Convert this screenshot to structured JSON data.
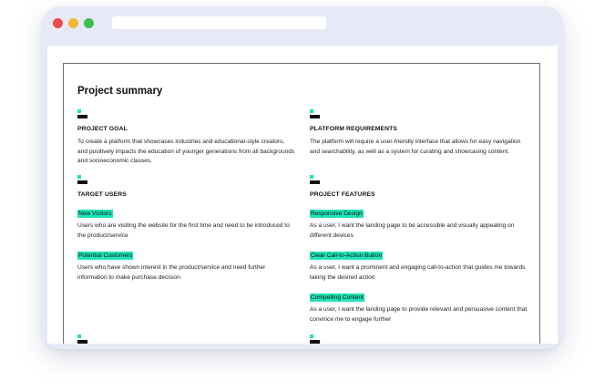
{
  "page": {
    "title": "Project summary"
  },
  "goal": {
    "heading": "PROJECT GOAL",
    "text": "To create a platform that showcases industries and educational-style creators, and positively impacts the education of younger generations from all backgrounds and socioeconomic classes."
  },
  "requirements": {
    "heading": "PLATFORM REQUIREMENTS",
    "text": "The platform will require a user-friendly interface that allows for easy navigation and searchability, as well as a system for curating and showcasing content."
  },
  "users": {
    "heading": "TARGET USERS",
    "items": [
      {
        "tag": "New Visitors",
        "text": "Users who are visiting the website for the first time and need to be introduced to the product/service"
      },
      {
        "tag": "Potential Customers",
        "text": "Users who have shown interest in the product/service and need further information to make purchase decision"
      }
    ]
  },
  "features": {
    "heading": "PROJECT FEATURES",
    "items": [
      {
        "tag": "Responsive Design",
        "text": "As a user, I want the landing page to be accessible and visually appealing on different devices"
      },
      {
        "tag": "Clear Call-to-Action Button",
        "text": "As a user, I want a prominent and engaging call-to-action that guides me towards taking the desired action"
      },
      {
        "tag": "Compelling Content",
        "text": "As a user, I want the landing page to provide relevant and persuasive content that convince me to engage further"
      }
    ]
  },
  "colors": {
    "accent": "#1fe3b6",
    "window_frame": "#e6eaf6",
    "close": "#ed4a4a",
    "minimize": "#f5b531",
    "maximize": "#3fbf4f"
  }
}
